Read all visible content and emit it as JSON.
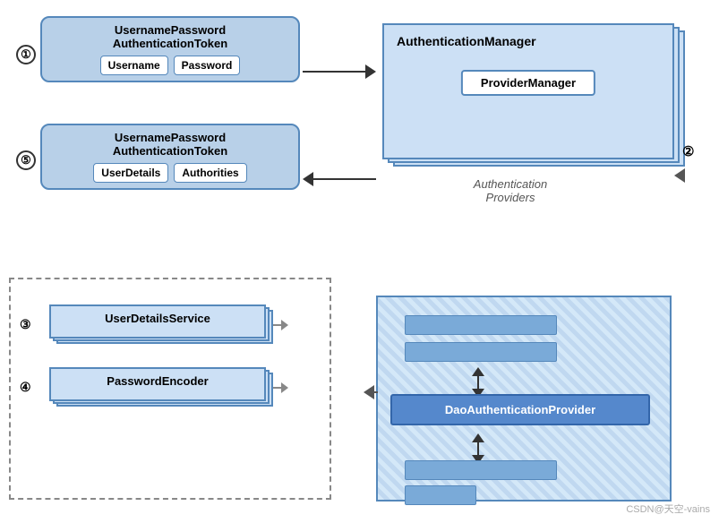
{
  "token1": {
    "title": "UsernamePassword\nAuthenticationToken",
    "fields": [
      "Username",
      "Password"
    ]
  },
  "token5": {
    "title": "UsernamePassword\nAuthenticationToken",
    "fields": [
      "UserDetails",
      "Authorities"
    ]
  },
  "authManager": {
    "title": "AuthenticationManager",
    "inner": "ProviderManager"
  },
  "authProviders": {
    "label": "Authentication\nProviders"
  },
  "numbers": {
    "n1": "①",
    "n2": "②",
    "n3": "③",
    "n4": "④",
    "n5": "⑤"
  },
  "services": {
    "userDetails": "UserDetailsService",
    "passwordEncoder": "PasswordEncoder"
  },
  "daoProvider": {
    "title": "DaoAuthenticationProvider"
  },
  "watermark": "CSDN@天空-vains"
}
